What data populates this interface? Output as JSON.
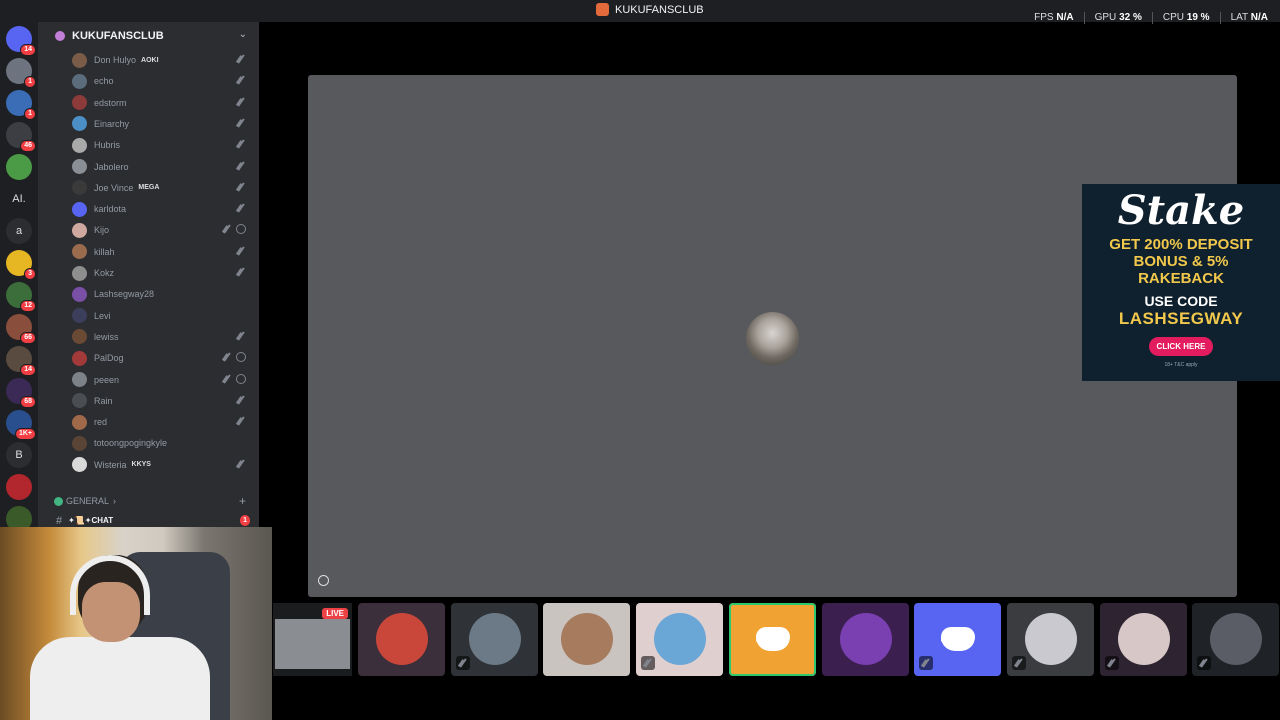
{
  "window": {
    "title": "KUKUFANSCLUB",
    "stats": [
      {
        "label": "FPS",
        "value": "N/A"
      },
      {
        "label": "GPU",
        "value": "32 %"
      },
      {
        "label": "CPU",
        "value": "19 %"
      },
      {
        "label": "LAT",
        "value": "N/A"
      }
    ]
  },
  "rail": {
    "servers": [
      {
        "badge": "14",
        "color": "#5865f2"
      },
      {
        "badge": "1",
        "color": "#6d7480"
      },
      {
        "badge": "1",
        "color": "#3a6db5"
      },
      {
        "badge": "46",
        "color": "#3d3d44"
      },
      {
        "badge": "",
        "color": "#4a9a46"
      },
      {
        "text": "AI.",
        "badge": "",
        "color": "#1e1f22"
      },
      {
        "text": "a",
        "badge": "",
        "color": "#2b2d31"
      },
      {
        "badge": "3",
        "color": "#e6b722"
      },
      {
        "badge": "12",
        "color": "#3b6e3a"
      },
      {
        "badge": "66",
        "color": "#8a4e3c"
      },
      {
        "badge": "14",
        "color": "#5a4b40"
      },
      {
        "badge": "68",
        "color": "#3a2a55"
      },
      {
        "badge": "1K+",
        "color": "#2a4f8f"
      },
      {
        "text": "B",
        "badge": "",
        "color": "#2b2d31"
      },
      {
        "badge": "",
        "color": "#b2272e"
      },
      {
        "badge": "",
        "color": "#3b5a2a"
      }
    ]
  },
  "server": {
    "name": "KUKUFANSCLUB",
    "members": [
      {
        "name": "Don Hulyo",
        "tag": "AOKI",
        "muted": true,
        "deaf": false,
        "color": "#7a5c48"
      },
      {
        "name": "echo",
        "tag": "",
        "muted": true,
        "deaf": false,
        "color": "#5b6d7c"
      },
      {
        "name": "edstorm",
        "tag": "",
        "muted": true,
        "deaf": false,
        "color": "#8c3a3a"
      },
      {
        "name": "Einarchy",
        "tag": "",
        "muted": true,
        "deaf": false,
        "color": "#4c8fc7"
      },
      {
        "name": "Hubris",
        "tag": "",
        "muted": true,
        "deaf": false,
        "color": "#a9a9a9"
      },
      {
        "name": "Jabolero",
        "tag": "",
        "muted": true,
        "deaf": false,
        "color": "#8a8f96"
      },
      {
        "name": "Joe Vince",
        "tag": "MEGA",
        "muted": true,
        "deaf": false,
        "color": "#3a3a3a"
      },
      {
        "name": "karldota",
        "tag": "",
        "muted": true,
        "deaf": false,
        "color": "#5865f2"
      },
      {
        "name": "Kijo",
        "tag": "",
        "muted": true,
        "deaf": true,
        "color": "#cfa9a0"
      },
      {
        "name": "killah",
        "tag": "",
        "muted": true,
        "deaf": false,
        "color": "#9b6b4d"
      },
      {
        "name": "Kokz",
        "tag": "",
        "muted": true,
        "deaf": false,
        "color": "#8e8e8e"
      },
      {
        "name": "Lashsegway28",
        "tag": "",
        "muted": false,
        "deaf": false,
        "color": "#7a4fa6"
      },
      {
        "name": "Levi",
        "tag": "",
        "muted": false,
        "deaf": false,
        "color": "#3b3f5c"
      },
      {
        "name": "lewiss",
        "tag": "",
        "muted": true,
        "deaf": false,
        "color": "#6b4a35"
      },
      {
        "name": "PalDog",
        "tag": "",
        "muted": true,
        "deaf": true,
        "color": "#a33a3a"
      },
      {
        "name": "peeen",
        "tag": "",
        "muted": true,
        "deaf": true,
        "color": "#7d8288"
      },
      {
        "name": "Rain",
        "tag": "",
        "muted": true,
        "deaf": false,
        "color": "#4a4d52"
      },
      {
        "name": "red",
        "tag": "",
        "muted": true,
        "deaf": false,
        "color": "#a06a4a"
      },
      {
        "name": "totoongpogingkyle",
        "tag": "",
        "muted": false,
        "deaf": false,
        "color": "#5a4436"
      },
      {
        "name": "Wisteria",
        "tag": "KKYS",
        "muted": true,
        "deaf": false,
        "color": "#d9d9d9"
      }
    ],
    "category": "GENERAL",
    "channel": {
      "name": "✦📜✦CHAT",
      "unread": "1"
    }
  },
  "stage": {
    "popout_icon": "popout-icon"
  },
  "ad": {
    "brand": "Stake",
    "line1": "GET 200% DEPOSIT",
    "line2": "BONUS & 5%",
    "line3": "RAKEBACK",
    "code_label": "USE CODE",
    "code": "LASHSEGWAY",
    "cta": "CLICK HERE",
    "fine": "18+ T&C apply"
  },
  "strip": {
    "live_label": "LIVE",
    "tiles": [
      {
        "bg": "#3a2f3a",
        "pic": "#c9473a",
        "muted": false,
        "discord": false
      },
      {
        "bg": "#2f3236",
        "pic": "#6b7a86",
        "muted": true,
        "discord": false
      },
      {
        "bg": "#c9c4bf",
        "pic": "#a77b5e",
        "muted": false,
        "discord": false
      },
      {
        "bg": "#e0cfcf",
        "pic": "#6aa6d6",
        "muted": true,
        "discord": false
      },
      {
        "bg": "#f0a232",
        "pic": "",
        "muted": false,
        "discord": true,
        "active": true
      },
      {
        "bg": "#3b1f4f",
        "pic": "#7a3fb0",
        "muted": false,
        "discord": false
      },
      {
        "bg": "#5865f2",
        "pic": "",
        "muted": true,
        "discord": true
      },
      {
        "bg": "#3b3c40",
        "pic": "#c9c9cf",
        "muted": true,
        "discord": false
      },
      {
        "bg": "#2e2330",
        "pic": "#d7c7c7",
        "muted": true,
        "discord": false
      },
      {
        "bg": "#1f2226",
        "pic": "#5a5d66",
        "muted": true,
        "discord": false
      }
    ]
  }
}
